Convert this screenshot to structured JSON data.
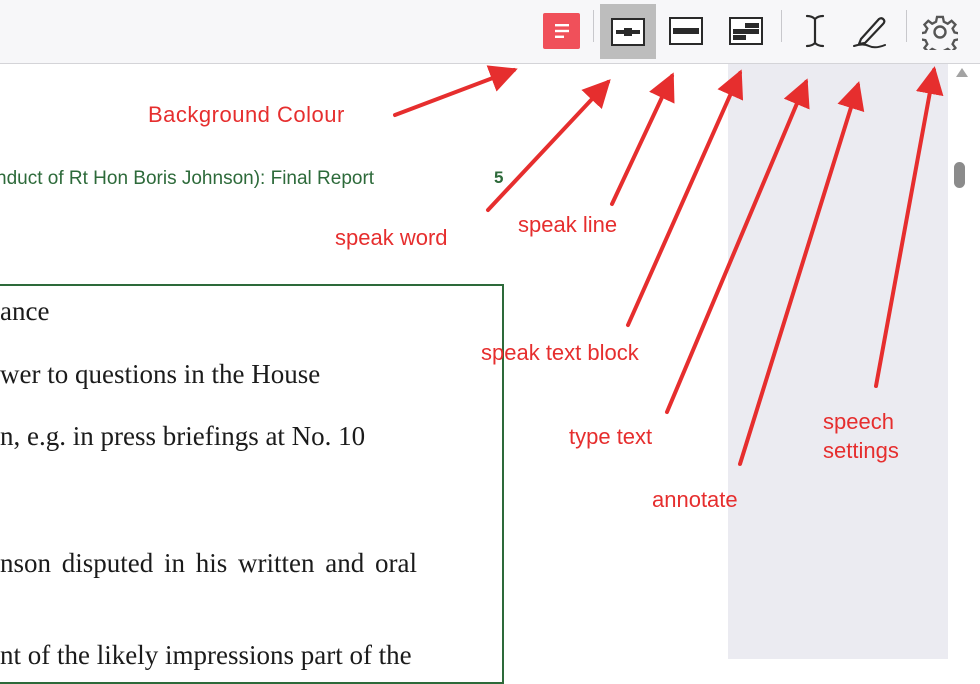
{
  "toolbar": {
    "buttons": [
      {
        "id": "background-colour",
        "icon": "background-colour-icon",
        "accent": "#f0505a"
      },
      {
        "id": "speak-word",
        "icon": "speak-word-icon",
        "active": true
      },
      {
        "id": "speak-line",
        "icon": "speak-line-icon"
      },
      {
        "id": "speak-text-block",
        "icon": "speak-text-block-icon"
      },
      {
        "id": "type-text",
        "icon": "text-cursor-icon"
      },
      {
        "id": "annotate",
        "icon": "pen-icon"
      },
      {
        "id": "speech-settings",
        "icon": "gear-icon"
      }
    ]
  },
  "document": {
    "header_text": "nduct of Rt Hon Boris Johnson): Final Report",
    "page_number": "5",
    "lines": [
      "ance",
      "wer to questions in the House",
      "n, e.g. in press briefings at No. 10",
      "nson disputed in his written and oral",
      "nt of the likely impressions part of the"
    ]
  },
  "annotations": {
    "background_colour": "Background Colour",
    "speak_word": "speak word",
    "speak_line": "speak line",
    "speak_text_block": "speak text block",
    "type_text": "type text",
    "annotate": "annotate",
    "speech_settings_1": "speech",
    "speech_settings_2": "settings"
  },
  "colors": {
    "annotation_red": "#e62e2e",
    "document_green": "#2d6a3a",
    "sidebar": "#ebebf1"
  }
}
